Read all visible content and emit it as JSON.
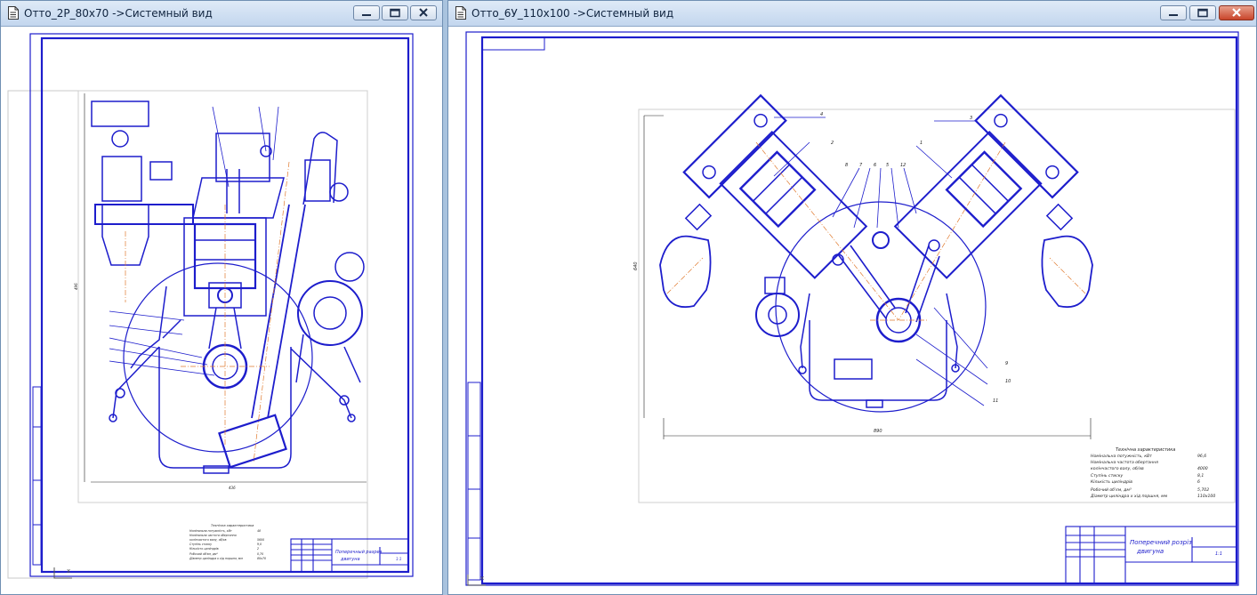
{
  "windows": [
    {
      "title": "Отто_2Р_80х70 ->Системный вид",
      "title_block": {
        "doc_title_line1": "Поперечный разрез",
        "doc_title_line2": "двигуна",
        "sheet": "1:1"
      },
      "spec_lines": [
        [
          "Технічна характеристика",
          ""
        ],
        [
          "Номінальна потужність, кВт",
          "48"
        ],
        [
          "Номінальна частота обертання",
          ""
        ],
        [
          "колінчастого валу, об/хв",
          "5600"
        ],
        [
          "Ступінь стиску",
          "9,0"
        ],
        [
          "Кількість циліндрів",
          "2"
        ],
        [
          "Робочий об'єм, дм³",
          "0,70"
        ],
        [
          "Діаметр циліндра х хід поршня, мм",
          "80х70"
        ]
      ],
      "dimensions": {
        "height": "496",
        "width": "436"
      }
    },
    {
      "title": "Отто_6У_110х100 ->Системный вид",
      "title_block": {
        "doc_title_line1": "Поперечний розріз",
        "doc_title_line2": "двигуна",
        "sheet": "1:1"
      },
      "spec_lines": [
        [
          "Технічна характеристика",
          ""
        ],
        [
          "Номінальна потужність, кВт",
          "96,6"
        ],
        [
          "Номінальна частота обертання",
          ""
        ],
        [
          "колінчастого валу, об/хв",
          "4000"
        ],
        [
          "Ступінь стиску",
          "8,1"
        ],
        [
          "Кількість циліндрів",
          "6"
        ],
        [
          "Робочий об'єм, дм³",
          "5,702"
        ],
        [
          "Діаметр циліндра х хід поршня, мм",
          "110х100"
        ]
      ],
      "dimensions": {
        "height": "640",
        "width": "890"
      },
      "leader_labels": [
        "4",
        "3",
        "2",
        "1",
        "8",
        "7",
        "6",
        "5",
        "12",
        "9",
        "10",
        "11"
      ]
    }
  ],
  "colors": {
    "desktop": "#a9c3de",
    "drawing": "#1d1dcc",
    "titlebar": "#c9daf0"
  },
  "icons": [
    "document-icon",
    "minimize-icon",
    "maximize-icon",
    "close-icon"
  ]
}
